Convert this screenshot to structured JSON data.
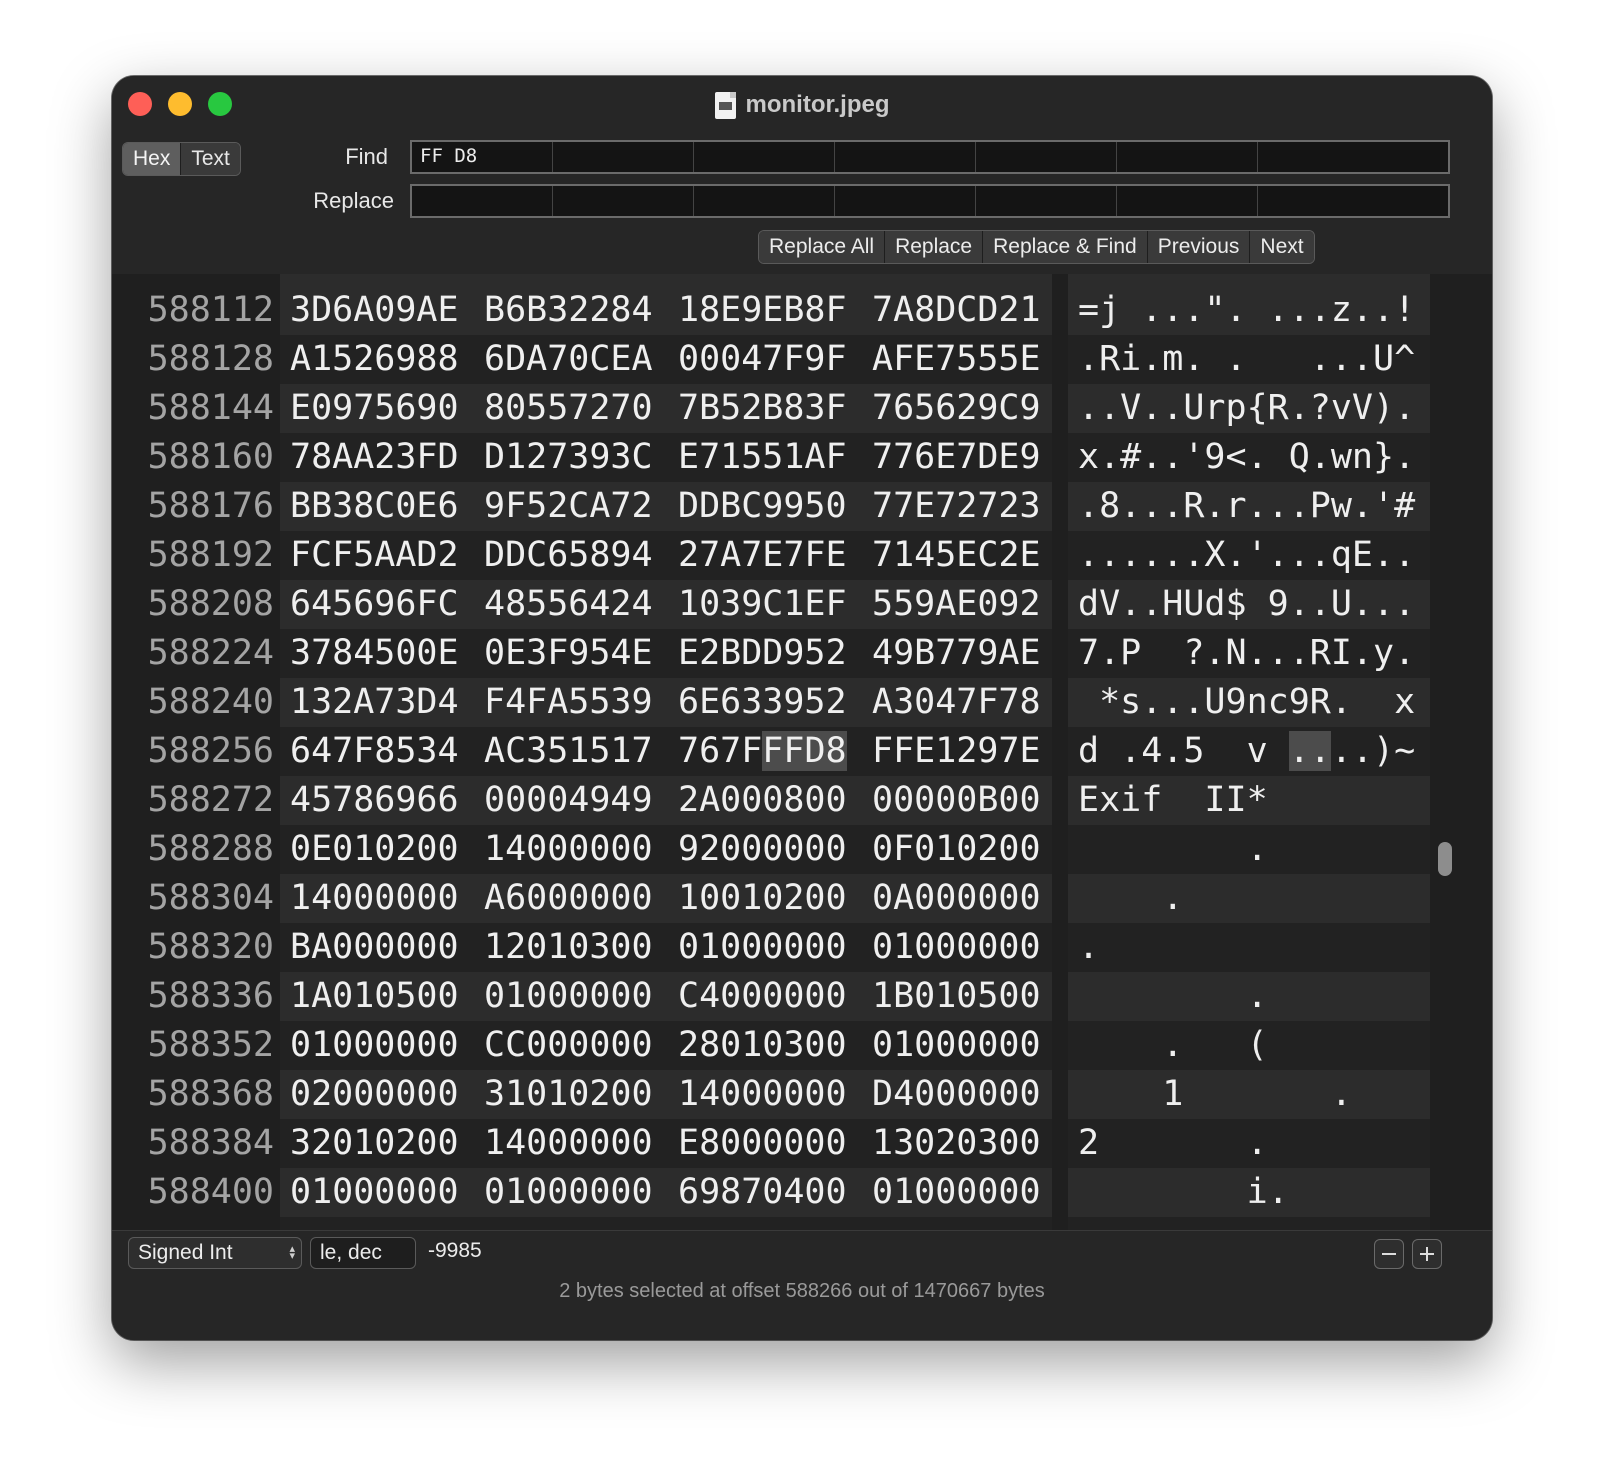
{
  "window": {
    "title": "monitor.jpeg"
  },
  "mode_toggle": {
    "hex": "Hex",
    "text": "Text",
    "selected": "Hex"
  },
  "find": {
    "label": "Find",
    "value": "FF D8"
  },
  "replace": {
    "label": "Replace",
    "value": ""
  },
  "actions": [
    "Replace All",
    "Replace",
    "Replace & Find",
    "Previous",
    "Next"
  ],
  "rows": [
    {
      "offset": "588112",
      "hex": [
        "3D6A09AE",
        "B6B32284",
        "18E9EB8F",
        "7A8DCD21"
      ],
      "ascii": "=j ...\". ...z..!"
    },
    {
      "offset": "588128",
      "hex": [
        "A1526988",
        "6DA70CEA",
        "00047F9F",
        "AFE7555E"
      ],
      "ascii": ".Ri.m. .   ...U^"
    },
    {
      "offset": "588144",
      "hex": [
        "E0975690",
        "80557270",
        "7B52B83F",
        "765629C9"
      ],
      "ascii": "..V..Urp{R.?vV)."
    },
    {
      "offset": "588160",
      "hex": [
        "78AA23FD",
        "D127393C",
        "E71551AF",
        "776E7DE9"
      ],
      "ascii": "x.#..'9<. Q.wn}."
    },
    {
      "offset": "588176",
      "hex": [
        "BB38C0E6",
        "9F52CA72",
        "DDBC9950",
        "77E72723"
      ],
      "ascii": ".8...R.r...Pw.'#"
    },
    {
      "offset": "588192",
      "hex": [
        "FCF5AAD2",
        "DDC65894",
        "27A7E7FE",
        "7145EC2E"
      ],
      "ascii": "......X.'...qE.."
    },
    {
      "offset": "588208",
      "hex": [
        "645696FC",
        "48556424",
        "1039C1EF",
        "559AE092"
      ],
      "ascii": "dV..HUd$ 9..U..."
    },
    {
      "offset": "588224",
      "hex": [
        "3784500E",
        "0E3F954E",
        "E2BDD952",
        "49B779AE"
      ],
      "ascii": "7.P  ?.N...RI.y."
    },
    {
      "offset": "588240",
      "hex": [
        "132A73D4",
        "F4FA5539",
        "6E633952",
        "A3047F78"
      ],
      "ascii": " *s...U9nc9R.  x"
    },
    {
      "offset": "588256",
      "hex": [
        "647F8534",
        "AC351517",
        "767FFFD8",
        "FFE1297E"
      ],
      "ascii": "d .4.5  v ....)~"
    },
    {
      "offset": "588272",
      "hex": [
        "45786966",
        "00004949",
        "2A000800",
        "00000B00"
      ],
      "ascii": "Exif  II*"
    },
    {
      "offset": "588288",
      "hex": [
        "0E010200",
        "14000000",
        "92000000",
        "0F010200"
      ],
      "ascii": "        ."
    },
    {
      "offset": "588304",
      "hex": [
        "14000000",
        "A6000000",
        "10010200",
        "0A000000"
      ],
      "ascii": "    ."
    },
    {
      "offset": "588320",
      "hex": [
        "BA000000",
        "12010300",
        "01000000",
        "01000000"
      ],
      "ascii": "."
    },
    {
      "offset": "588336",
      "hex": [
        "1A010500",
        "01000000",
        "C4000000",
        "1B010500"
      ],
      "ascii": "        ."
    },
    {
      "offset": "588352",
      "hex": [
        "01000000",
        "CC000000",
        "28010300",
        "01000000"
      ],
      "ascii": "    .   ("
    },
    {
      "offset": "588368",
      "hex": [
        "02000000",
        "31010200",
        "14000000",
        "D4000000"
      ],
      "ascii": "    1       ."
    },
    {
      "offset": "588384",
      "hex": [
        "32010200",
        "14000000",
        "E8000000",
        "13020300"
      ],
      "ascii": "2       ."
    },
    {
      "offset": "588400",
      "hex": [
        "01000000",
        "01000000",
        "69870400",
        "01000000"
      ],
      "ascii": "        i."
    }
  ],
  "inspector": {
    "type": "Signed Int",
    "format": "le, dec",
    "value": "-9985"
  },
  "status": {
    "text": "2 bytes selected at offset 588266 out of 1470667 bytes"
  }
}
